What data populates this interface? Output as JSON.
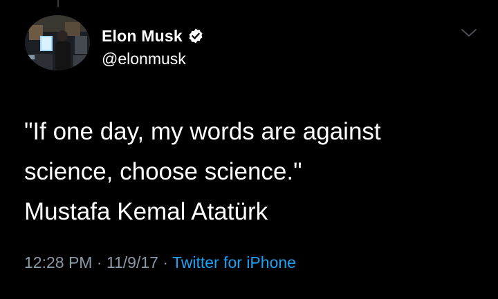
{
  "author": {
    "display_name": "Elon Musk",
    "handle": "@elonmusk",
    "verified": true,
    "avatar_icon": "profile-photo"
  },
  "tweet": {
    "lines": [
      "\"If one day, my words are against",
      "science, choose science.\"",
      "Mustafa Kemal Atatürk"
    ]
  },
  "meta": {
    "time": "12:28 PM",
    "separator": " · ",
    "date": "11/9/17",
    "source": "Twitter for iPhone"
  },
  "colors": {
    "background": "#000000",
    "text": "#ffffff",
    "secondary_text": "#8b98a5",
    "accent": "#1da1f2"
  },
  "icons": {
    "verified": "verified-badge-icon",
    "menu": "chevron-down-icon"
  }
}
